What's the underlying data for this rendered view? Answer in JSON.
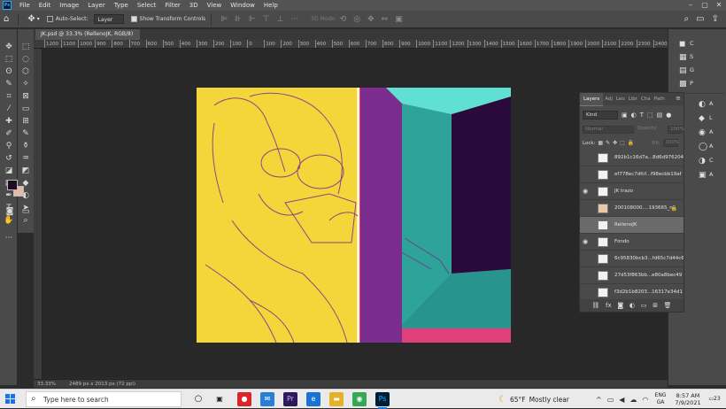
{
  "menubar": {
    "items": [
      "File",
      "Edit",
      "Image",
      "Layer",
      "Type",
      "Select",
      "Filter",
      "3D",
      "View",
      "Window",
      "Help"
    ],
    "logo": "Ps"
  },
  "options": {
    "auto_select_label": "Auto-Select:",
    "auto_select_value": "Layer",
    "show_transform_label": "Show Transform Controls",
    "mode_label": "3D Mode:"
  },
  "document": {
    "tab_title": "JK.psd @ 33.3% (RellenoJK, RGB/8) *",
    "zoom": "33.33%",
    "info": "2489 px x 2013 px (72 ppi)"
  },
  "ruler": {
    "ticks": [
      "1200",
      "1100",
      "1000",
      "900",
      "800",
      "700",
      "600",
      "500",
      "400",
      "300",
      "200",
      "100",
      "0",
      "100",
      "200",
      "300",
      "400",
      "500",
      "600",
      "700",
      "800",
      "900",
      "1000",
      "1100",
      "1200",
      "1300",
      "1400",
      "1500",
      "1600",
      "1700",
      "1800",
      "1900",
      "2000",
      "2100",
      "2200",
      "2300",
      "2400",
      "2500",
      "2600",
      "2700"
    ]
  },
  "dock": {
    "labels": [
      "C",
      "S",
      "G",
      "P"
    ],
    "group2_labels": [
      "A",
      "L",
      "A",
      "A",
      "C",
      "A"
    ]
  },
  "layers_panel": {
    "tabs": [
      "Layers",
      "Adj",
      "Leo",
      "Libr",
      "Cha",
      "Path"
    ],
    "kind": "Kind",
    "blend_mode": "Normal",
    "opacity_label": "Opacity:",
    "opacity_value": "100%",
    "lock_label": "Lock:",
    "fill_label": "Fill:",
    "fill_value": "100%",
    "layers": [
      {
        "name": "892b1c16d7a...8d6d976204",
        "visible": false,
        "locked": false,
        "selected": false
      },
      {
        "name": "ef778ec7dfcf...f98ecbb19af",
        "visible": false,
        "locked": false,
        "selected": false
      },
      {
        "name": "JK trazo",
        "visible": true,
        "locked": false,
        "selected": false
      },
      {
        "name": "200108000....193665_n",
        "visible": false,
        "locked": true,
        "selected": false
      },
      {
        "name": "RellenoJK",
        "visible": false,
        "locked": false,
        "selected": true
      },
      {
        "name": "Fondo",
        "visible": true,
        "locked": false,
        "selected": false
      },
      {
        "name": "6c95830bcb3...fd65c7d44c6",
        "visible": false,
        "locked": false,
        "selected": false
      },
      {
        "name": "27d53f863bb...e80a8bec49",
        "visible": false,
        "locked": false,
        "selected": false
      },
      {
        "name": "f3d2b1b8203...16317e34d1",
        "visible": false,
        "locked": false,
        "selected": false
      }
    ],
    "footer_icons": [
      "link-icon",
      "fx-icon",
      "mask-icon",
      "adjustment-icon",
      "folder-icon",
      "new-layer-icon",
      "trash-icon"
    ]
  },
  "taskbar": {
    "search_placeholder": "Type here to search",
    "weather_temp": "65°F",
    "weather_desc": "Mostly clear",
    "lang1": "ENG",
    "lang2": "GA",
    "time": "8:57 AM",
    "date": "7/9/2021",
    "notif_count": "23"
  },
  "colors": {
    "foreground": "#1e0d20",
    "background": "#e7b8a6",
    "art_yellow": "#f5d63a",
    "art_purple": "#7b2d8e",
    "art_teal": "#2ea39a",
    "art_pink": "#e2407a"
  }
}
